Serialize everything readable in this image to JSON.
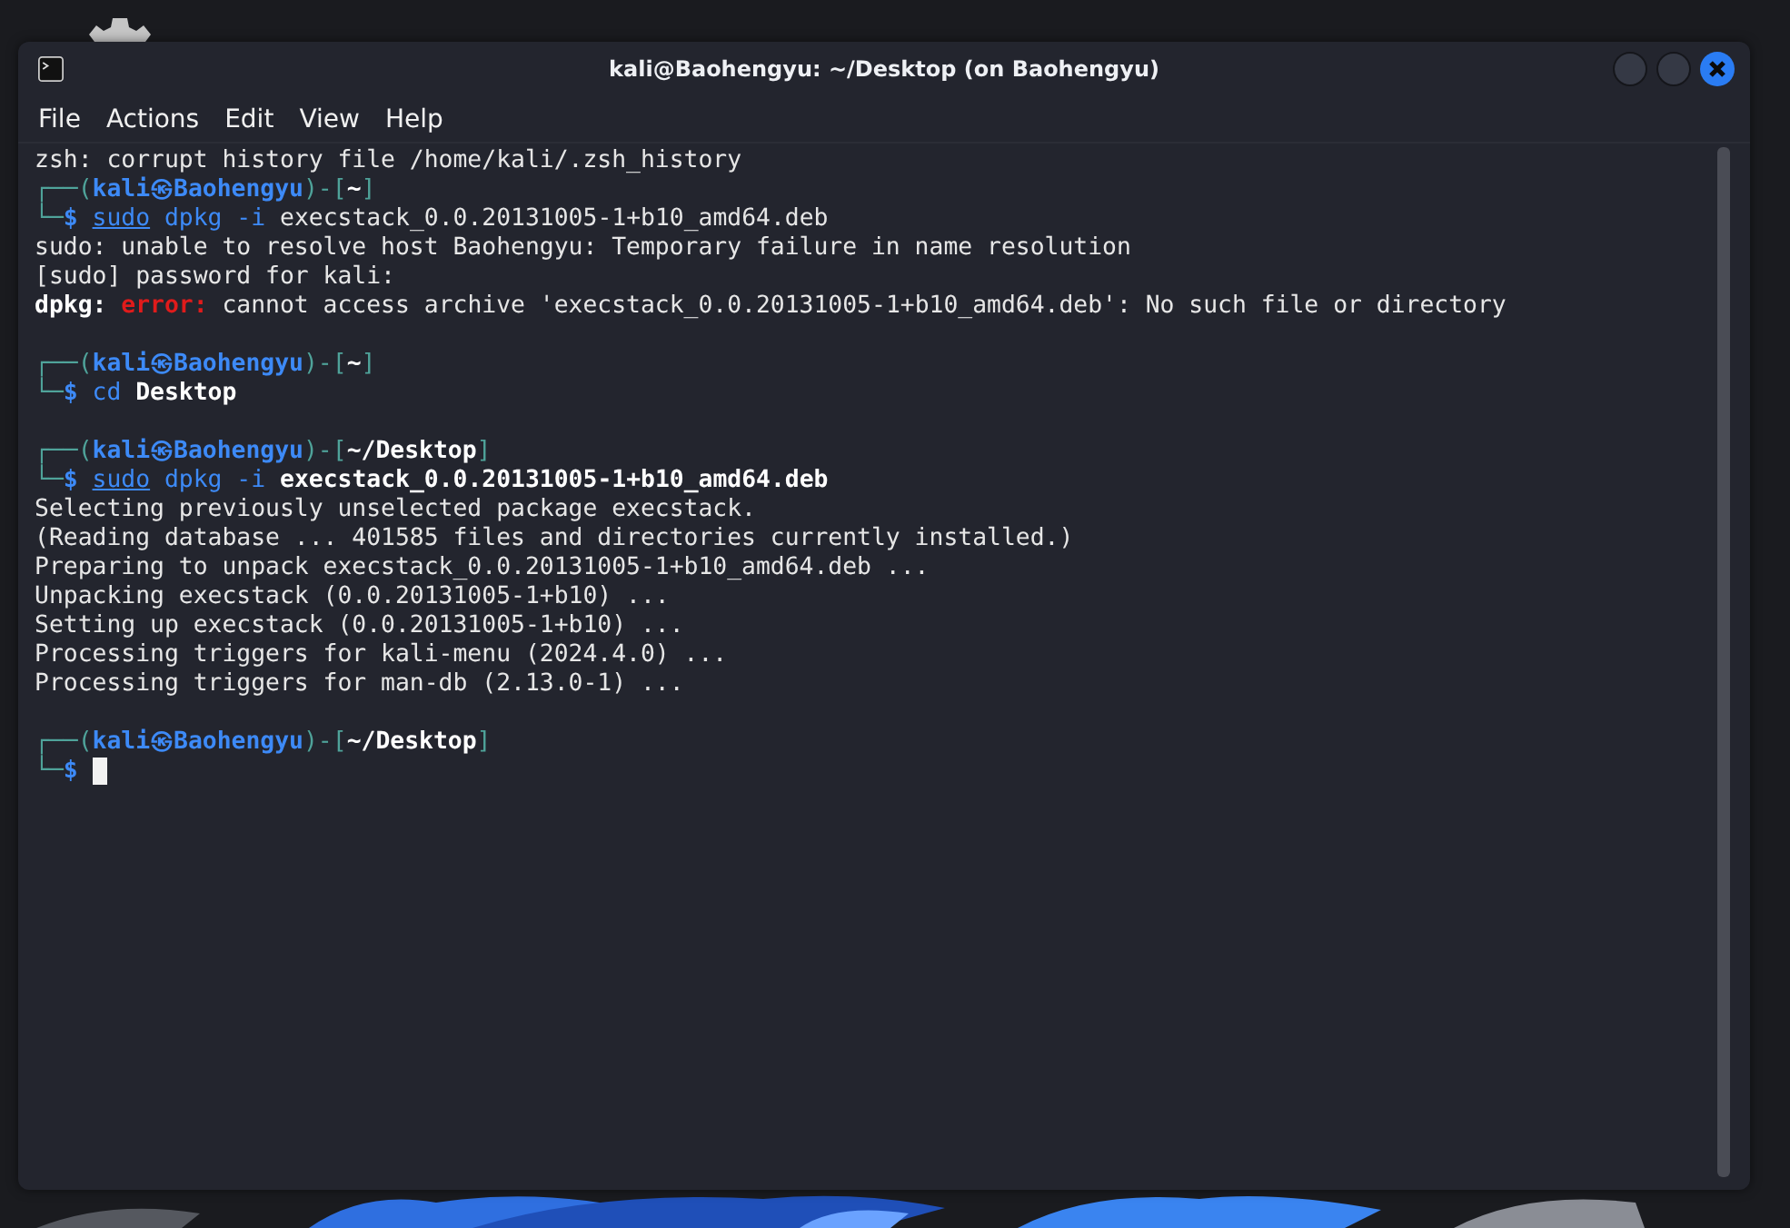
{
  "window": {
    "title": "kali@Baohengyu: ~/Desktop (on Baohengyu)"
  },
  "menu": [
    {
      "label": "File"
    },
    {
      "label": "Actions"
    },
    {
      "label": "Edit"
    },
    {
      "label": "View"
    },
    {
      "label": "Help"
    }
  ],
  "terminal": {
    "lines": [
      {
        "kind": "text",
        "segments": [
          {
            "text": "zsh: corrupt history file /home/kali/.zsh_history",
            "kind": "plain"
          }
        ]
      },
      {
        "kind": "text",
        "segments": [
          {
            "text": "┌──(",
            "kind": "frame"
          },
          {
            "text": "kali㉿Baohengyu",
            "kind": "user"
          },
          {
            "text": ")-[",
            "kind": "frame"
          },
          {
            "text": "~",
            "kind": "path"
          },
          {
            "text": "]",
            "kind": "frame"
          }
        ]
      },
      {
        "kind": "text",
        "segments": [
          {
            "text": "└─",
            "kind": "frame"
          },
          {
            "text": "$ ",
            "kind": "user"
          },
          {
            "text": "sudo",
            "kind": "underlined"
          },
          {
            "text": " dpkg -i",
            "kind": "command"
          },
          {
            "text": " execstack_0.0.20131005-1+b10_amd64.deb",
            "kind": "plain"
          }
        ]
      },
      {
        "kind": "text",
        "segments": [
          {
            "text": "sudo: unable to resolve host Baohengyu: Temporary failure in name resolution",
            "kind": "plain"
          }
        ]
      },
      {
        "kind": "text",
        "segments": [
          {
            "text": "[sudo] password for kali:",
            "kind": "plain"
          }
        ]
      },
      {
        "kind": "text",
        "segments": [
          {
            "text": "dpkg: ",
            "kind": "bold"
          },
          {
            "text": "error:",
            "kind": "error"
          },
          {
            "text": " cannot access archive 'execstack_0.0.20131005-1+b10_amd64.deb': No such file or directory",
            "kind": "plain"
          }
        ]
      },
      {
        "kind": "blank"
      },
      {
        "kind": "text",
        "segments": [
          {
            "text": "┌──(",
            "kind": "frame"
          },
          {
            "text": "kali㉿Baohengyu",
            "kind": "user"
          },
          {
            "text": ")-[",
            "kind": "frame"
          },
          {
            "text": "~",
            "kind": "path"
          },
          {
            "text": "]",
            "kind": "frame"
          }
        ]
      },
      {
        "kind": "text",
        "segments": [
          {
            "text": "└─",
            "kind": "frame"
          },
          {
            "text": "$ ",
            "kind": "user"
          },
          {
            "text": "cd",
            "kind": "command"
          },
          {
            "text": " Desktop",
            "kind": "bold"
          }
        ]
      },
      {
        "kind": "blank"
      },
      {
        "kind": "text",
        "segments": [
          {
            "text": "┌──(",
            "kind": "frame"
          },
          {
            "text": "kali㉿Baohengyu",
            "kind": "user"
          },
          {
            "text": ")-[",
            "kind": "frame"
          },
          {
            "text": "~/Desktop",
            "kind": "path"
          },
          {
            "text": "]",
            "kind": "frame"
          }
        ]
      },
      {
        "kind": "text",
        "segments": [
          {
            "text": "└─",
            "kind": "frame"
          },
          {
            "text": "$ ",
            "kind": "user"
          },
          {
            "text": "sudo",
            "kind": "underlined"
          },
          {
            "text": " dpkg -i",
            "kind": "command"
          },
          {
            "text": " execstack_0.0.20131005-1+b10_amd64.deb",
            "kind": "bold"
          }
        ]
      },
      {
        "kind": "text",
        "segments": [
          {
            "text": "Selecting previously unselected package execstack.",
            "kind": "plain"
          }
        ]
      },
      {
        "kind": "text",
        "segments": [
          {
            "text": "(Reading database ... 401585 files and directories currently installed.)",
            "kind": "plain"
          }
        ]
      },
      {
        "kind": "text",
        "segments": [
          {
            "text": "Preparing to unpack execstack_0.0.20131005-1+b10_amd64.deb ...",
            "kind": "plain"
          }
        ]
      },
      {
        "kind": "text",
        "segments": [
          {
            "text": "Unpacking execstack (0.0.20131005-1+b10) ...",
            "kind": "plain"
          }
        ]
      },
      {
        "kind": "text",
        "segments": [
          {
            "text": "Setting up execstack (0.0.20131005-1+b10) ...",
            "kind": "plain"
          }
        ]
      },
      {
        "kind": "text",
        "segments": [
          {
            "text": "Processing triggers for kali-menu (2024.4.0) ...",
            "kind": "plain"
          }
        ]
      },
      {
        "kind": "text",
        "segments": [
          {
            "text": "Processing triggers for man-db (2.13.0-1) ...",
            "kind": "plain"
          }
        ]
      },
      {
        "kind": "blank"
      },
      {
        "kind": "text",
        "segments": [
          {
            "text": "┌──(",
            "kind": "frame"
          },
          {
            "text": "kali㉿Baohengyu",
            "kind": "user"
          },
          {
            "text": ")-[",
            "kind": "frame"
          },
          {
            "text": "~/Desktop",
            "kind": "path"
          },
          {
            "text": "]",
            "kind": "frame"
          }
        ]
      },
      {
        "kind": "text",
        "segments": [
          {
            "text": "└─",
            "kind": "frame"
          },
          {
            "text": "$ ",
            "kind": "user"
          }
        ],
        "cursor": true
      }
    ]
  }
}
